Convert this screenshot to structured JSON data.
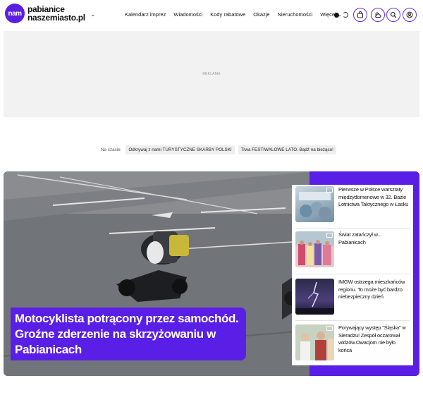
{
  "header": {
    "logo_mark": "nam",
    "logo_line1": "pabianice",
    "logo_line2": "naszemiasto.pl",
    "nav": [
      "Kalendarz imprez",
      "Wiadomości",
      "Kody rabatowe",
      "Okazje",
      "Nieruchomości",
      "Więcej ⌄"
    ],
    "icons": [
      "theme-toggle-icon",
      "shopping-bag-icon",
      "weather-icon",
      "search-icon",
      "user-icon"
    ]
  },
  "ad": {
    "label": "REKLAMA"
  },
  "trending": {
    "label": "Na czasie:",
    "chips": [
      "Odkrywaj z nami TURYSTYCZNE SKARBY POLSKI",
      "Trwa FESTIWALOWE LATO. Bądź na bieżąco!"
    ]
  },
  "hero": {
    "headline": "Motocyklista potrącony przez samochód. Groźne zderzenie na skrzyżowaniu w Pabianicach"
  },
  "side_articles": [
    {
      "title": "Pierwsze w Polsce warsztaty międzydomenowe w 32. Bazie Lotnictwa Taktycznego w Łasku"
    },
    {
      "title": "Świat zatańczył w... Pabianicach"
    },
    {
      "title": "IMGW ostrzega mieszkańców regionu. To może być bardzo niebezpieczny dzień"
    },
    {
      "title": "Porywający występ \"Śląska\" w Sieradzu! Zespół oczarował widzów.Owacjom nie było końca"
    }
  ],
  "colors": {
    "brand": "#5a1fe6"
  }
}
